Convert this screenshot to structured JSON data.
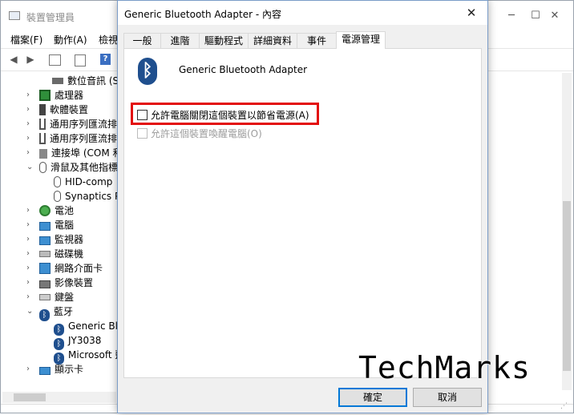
{
  "background_window": {
    "title": "裝置管理員",
    "menu": [
      "檔案(F)",
      "動作(A)",
      "檢視"
    ],
    "window_controls": {
      "minimize": "─",
      "maximize": "☐",
      "close": "✕"
    },
    "tree": [
      {
        "label": "數位音訊 (S",
        "icon": "audio-icon",
        "chevron": ""
      },
      {
        "label": "處理器",
        "icon": "processor-icon",
        "chevron": "›"
      },
      {
        "label": "軟體裝置",
        "icon": "software-device-icon",
        "chevron": "›"
      },
      {
        "label": "通用序列匯流排",
        "icon": "usb-icon",
        "chevron": "›"
      },
      {
        "label": "通用序列匯流排",
        "icon": "usb-icon",
        "chevron": "›"
      },
      {
        "label": "連接埠 (COM 和",
        "icon": "port-icon",
        "chevron": "›"
      },
      {
        "label": "滑鼠及其他指標",
        "icon": "mouse-icon",
        "chevron": "⌄"
      },
      {
        "label": "HID-comp",
        "icon": "mouse-icon",
        "chevron": ""
      },
      {
        "label": "Synaptics P",
        "icon": "mouse-icon",
        "chevron": ""
      },
      {
        "label": "電池",
        "icon": "battery-icon",
        "chevron": "›"
      },
      {
        "label": "電腦",
        "icon": "computer-icon",
        "chevron": "›"
      },
      {
        "label": "監視器",
        "icon": "monitor-icon",
        "chevron": "›"
      },
      {
        "label": "磁碟機",
        "icon": "disk-icon",
        "chevron": "›"
      },
      {
        "label": "網路介面卡",
        "icon": "network-icon",
        "chevron": "›"
      },
      {
        "label": "影像裝置",
        "icon": "camera-icon",
        "chevron": "›"
      },
      {
        "label": "鍵盤",
        "icon": "keyboard-icon",
        "chevron": "›"
      },
      {
        "label": "藍牙",
        "icon": "bluetooth-icon",
        "chevron": "⌄"
      },
      {
        "label": "Generic Blu",
        "icon": "bluetooth-icon",
        "chevron": ""
      },
      {
        "label": "JY3038",
        "icon": "bluetooth-icon",
        "chevron": ""
      },
      {
        "label": "Microsoft 藍",
        "icon": "bluetooth-icon",
        "chevron": ""
      },
      {
        "label": "顯示卡",
        "icon": "display-adapter-icon",
        "chevron": "›"
      }
    ]
  },
  "dialog": {
    "title": "Generic Bluetooth Adapter - 內容",
    "close_label": "✕",
    "tabs": [
      "一般",
      "進階",
      "驅動程式",
      "詳細資料",
      "事件",
      "電源管理"
    ],
    "active_tab": "電源管理",
    "device_name": "Generic Bluetooth Adapter",
    "bluetooth_glyph": "ᛒ",
    "options": [
      {
        "label": "允許電腦關閉這個裝置以節省電源(A)",
        "checked": false,
        "enabled": true
      },
      {
        "label": "允許這個裝置喚醒電腦(O)",
        "checked": false,
        "enabled": false
      }
    ],
    "ok_label": "確定",
    "cancel_label": "取消"
  },
  "watermark": "TechMarks",
  "colors": {
    "highlight_border": "#e30c0c",
    "primary_button_border": "#0078d7",
    "bluetooth_icon": "#1f4f8e"
  }
}
